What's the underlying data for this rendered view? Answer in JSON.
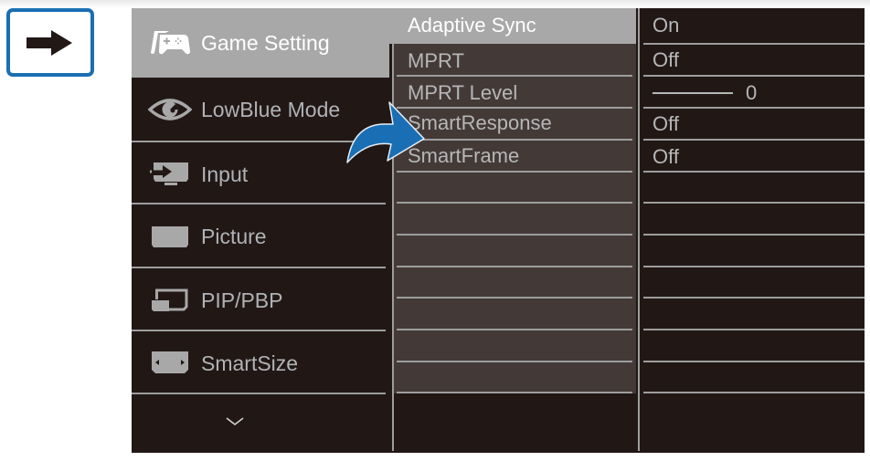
{
  "indicator": {
    "icon": "right-arrow-icon",
    "border_color": "#1a6fb4"
  },
  "menu": {
    "items": [
      {
        "label": "Game Setting",
        "icon": "gamepad-icon",
        "active": true
      },
      {
        "label": "LowBlue Mode",
        "icon": "eye-icon",
        "active": false
      },
      {
        "label": "Input",
        "icon": "input-icon",
        "active": false
      },
      {
        "label": "Picture",
        "icon": "picture-icon",
        "active": false
      },
      {
        "label": "PIP/PBP",
        "icon": "pip-pbp-icon",
        "active": false
      },
      {
        "label": "SmartSize",
        "icon": "smartsize-icon",
        "active": false
      }
    ],
    "more_icon": "chevron-down-icon"
  },
  "submenu": {
    "items": [
      {
        "label": "Adaptive Sync",
        "value": "On",
        "active": true
      },
      {
        "label": "MPRT",
        "value": "Off"
      },
      {
        "label": "MPRT Level",
        "value": "0",
        "control": "slider"
      },
      {
        "label": "SmartResponse",
        "value": "Off"
      },
      {
        "label": "SmartFrame",
        "value": "Off"
      }
    ]
  },
  "callout_icon": "curved-arrow-icon",
  "colors": {
    "osd_background": "#211816",
    "highlight": "#a8a8a8",
    "submenu_background": "#433a38",
    "callout_arrow": "#1a6fb4",
    "text": "#b6b6b8"
  }
}
